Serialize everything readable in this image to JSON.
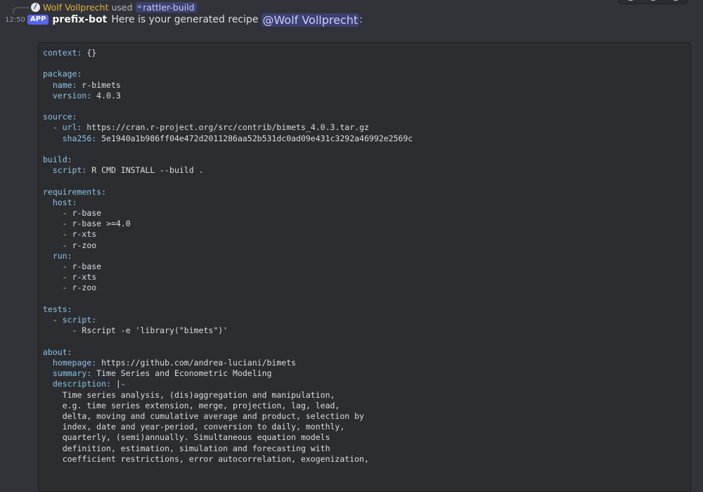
{
  "interaction": {
    "invoker": "Wolf Vollprecht",
    "used_text": "used",
    "command_icon": "hashtag-icon",
    "command": "rattler-build",
    "command_badge": "/"
  },
  "message": {
    "timestamp": "12:50",
    "app_tag": "APP",
    "author": "prefix-bot",
    "text": "Here is your generated recipe",
    "mention": "@Wolf Vollprecht",
    "suffix": ":"
  },
  "colors": {
    "background": "#313338",
    "code_background": "#2b2d31",
    "key": "#8cc4e8",
    "dash": "#e5c07b",
    "invoker": "#e0b43c",
    "app_tag": "#5865f2"
  },
  "code": {
    "lines": [
      {
        "key": "context:",
        "value": " {}"
      },
      {
        "value": ""
      },
      {
        "key": "package:"
      },
      {
        "indent": "  ",
        "key": "name:",
        "value": " r-bimets"
      },
      {
        "indent": "  ",
        "key": "version:",
        "value": " 4.0.3"
      },
      {
        "value": ""
      },
      {
        "key": "source:"
      },
      {
        "indent": "  ",
        "dash": "-",
        "key": " url:",
        "value": " https://cran.r-project.org/src/contrib/bimets_4.0.3.tar.gz"
      },
      {
        "indent": "    ",
        "key": "sha256:",
        "value": " 5e1940a1b986ff04e472d2011286aa52b531dc0ad09e431c3292a46992e2569c"
      },
      {
        "value": ""
      },
      {
        "key": "build:"
      },
      {
        "indent": "  ",
        "key": "script:",
        "value": " R CMD INSTALL --build ."
      },
      {
        "value": ""
      },
      {
        "key": "requirements:"
      },
      {
        "indent": "  ",
        "key": "host:"
      },
      {
        "indent": "    ",
        "dash": "-",
        "value": " r-base"
      },
      {
        "indent": "    ",
        "dash": "-",
        "value": " r-base >=4.0"
      },
      {
        "indent": "    ",
        "dash": "-",
        "value": " r-xts"
      },
      {
        "indent": "    ",
        "dash": "-",
        "value": " r-zoo"
      },
      {
        "indent": "  ",
        "key": "run:"
      },
      {
        "indent": "    ",
        "dash": "-",
        "value": " r-base"
      },
      {
        "indent": "    ",
        "dash": "-",
        "value": " r-xts"
      },
      {
        "indent": "    ",
        "dash": "-",
        "value": " r-zoo"
      },
      {
        "value": ""
      },
      {
        "key": "tests:"
      },
      {
        "indent": "  ",
        "dash": "-",
        "key": " script:"
      },
      {
        "indent": "      ",
        "value": "- Rscript -e 'library(\"bimets\")'"
      },
      {
        "value": ""
      },
      {
        "key": "about:"
      },
      {
        "indent": "  ",
        "key": "homepage:",
        "value": " https://github.com/andrea-luciani/bimets"
      },
      {
        "indent": "  ",
        "key": "summary:",
        "value": " Time Series and Econometric Modeling"
      },
      {
        "indent": "  ",
        "key": "description:",
        "value": " |-"
      },
      {
        "indent": "    ",
        "value": "Time series analysis, (dis)aggregation and manipulation,"
      },
      {
        "indent": "    ",
        "value": "e.g. time series extension, merge, projection, lag, lead,"
      },
      {
        "indent": "    ",
        "value": "delta, moving and cumulative average and product, selection by"
      },
      {
        "indent": "    ",
        "value": "index, date and year-period, conversion to daily, monthly,"
      },
      {
        "indent": "    ",
        "value": "quarterly, (semi)annually. Simultaneous equation models"
      },
      {
        "indent": "    ",
        "value": "definition, estimation, simulation and forecasting with"
      },
      {
        "indent": "    ",
        "value": "coefficient restrictions, error autocorrelation, exogenization,"
      }
    ]
  }
}
